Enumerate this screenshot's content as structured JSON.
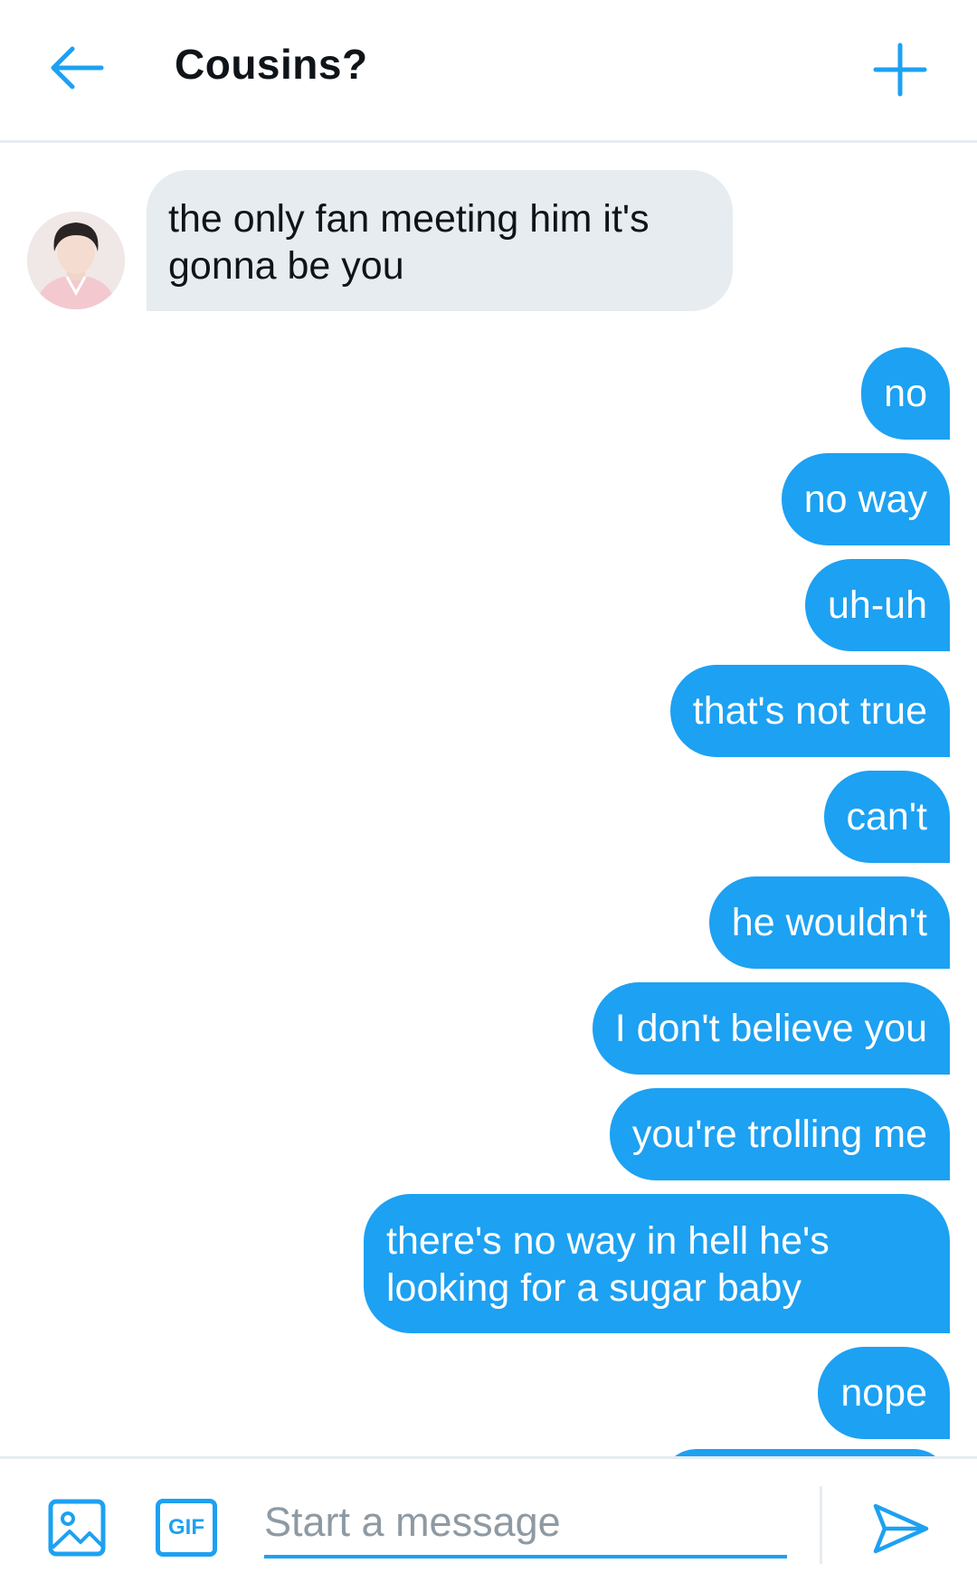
{
  "header": {
    "title": "Cousins?",
    "back_icon": "back-arrow-icon",
    "add_icon": "plus-icon",
    "accent_color": "#1da1f2"
  },
  "messages": {
    "incoming": [
      {
        "text": "the only fan meeting him it's gonna be you"
      }
    ],
    "outgoing": [
      {
        "text": "no"
      },
      {
        "text": "no way"
      },
      {
        "text": "uh-uh"
      },
      {
        "text": "that's not true"
      },
      {
        "text": "can't"
      },
      {
        "text": "he wouldn't"
      },
      {
        "text": "I don't believe you"
      },
      {
        "text": "you're trolling me"
      },
      {
        "text": "there's no way in hell he's looking for a sugar baby"
      },
      {
        "text": "nope"
      }
    ],
    "incoming_bubble_color": "#e6ecf0",
    "outgoing_bubble_color": "#1da1f2"
  },
  "composer": {
    "placeholder": "Start a message",
    "gif_label": "GIF",
    "media_icon": "image-icon",
    "send_icon": "send-icon"
  }
}
